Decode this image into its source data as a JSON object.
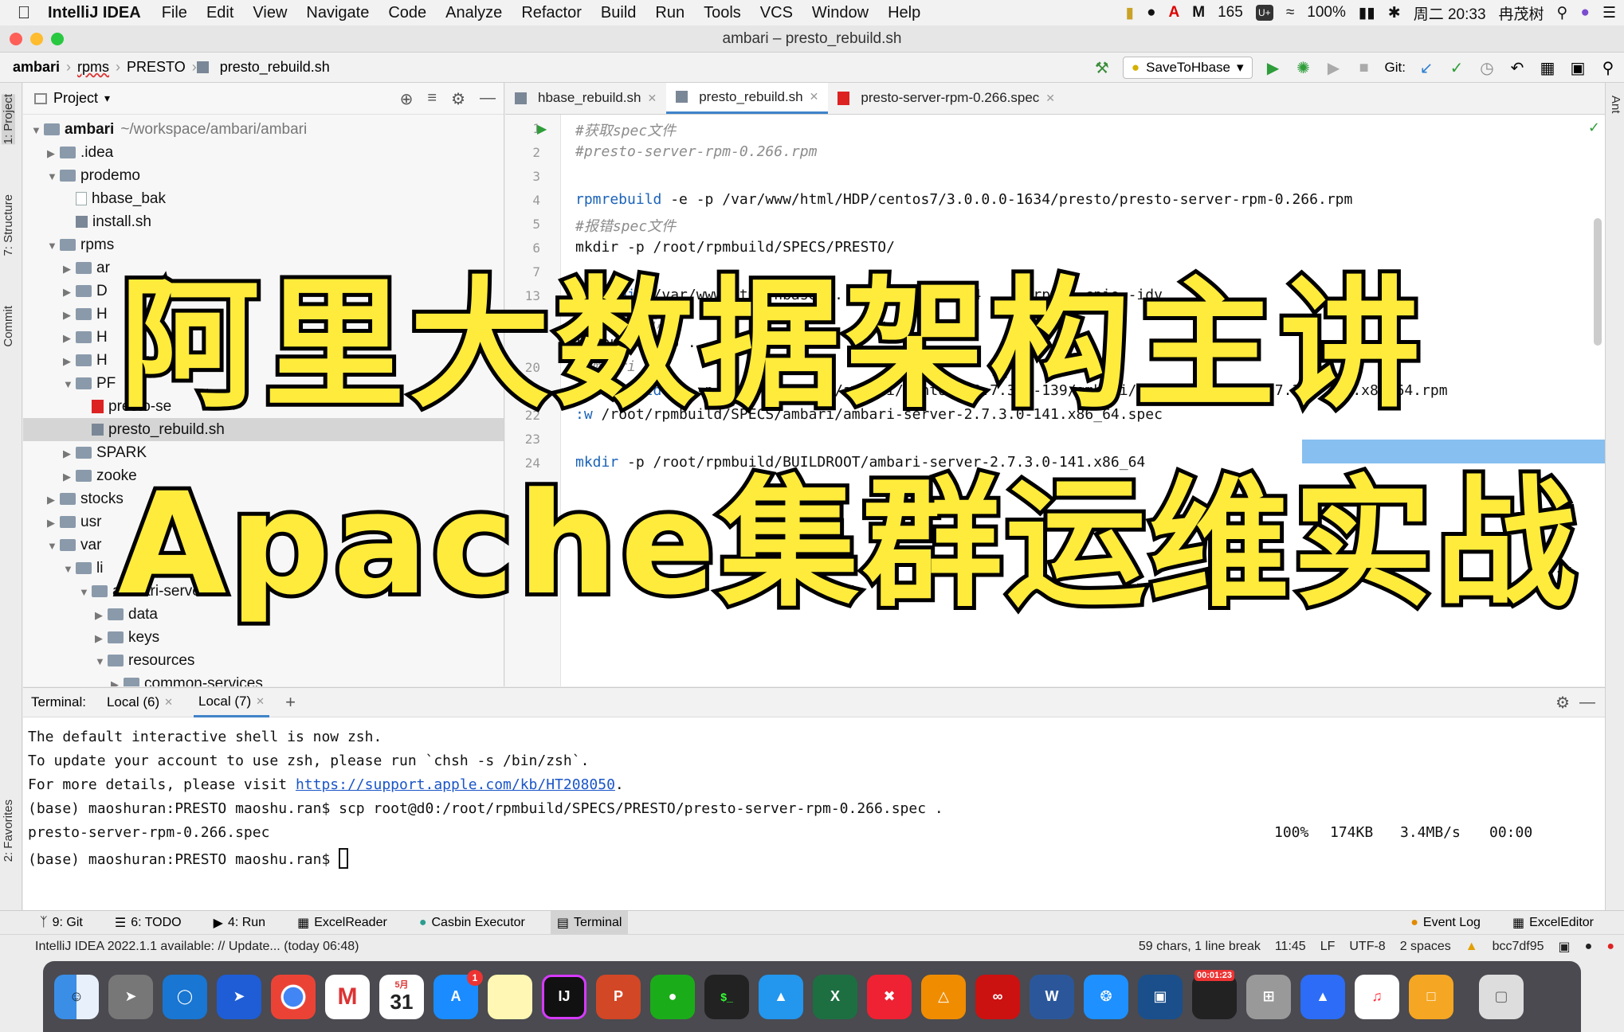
{
  "menubar": {
    "app_name": "IntelliJ IDEA",
    "items": [
      "File",
      "Edit",
      "View",
      "Navigate",
      "Code",
      "Analyze",
      "Refactor",
      "Build",
      "Run",
      "Tools",
      "VCS",
      "Window",
      "Help"
    ],
    "mail_count": "165",
    "battery": "100%",
    "datetime": "周二 20:33",
    "user": "冉茂树"
  },
  "window": {
    "title": "ambari – presto_rebuild.sh"
  },
  "navbar": {
    "breadcrumbs": [
      "ambari",
      "rpms",
      "PRESTO",
      "presto_rebuild.sh"
    ],
    "run_config": "SaveToHbase",
    "git_label": "Git:"
  },
  "leftstrip": {
    "project": "1: Project",
    "structure": "7: Structure",
    "commit": "Commit",
    "favorites": "2: Favorites"
  },
  "rightstrip": {
    "ant": "Ant"
  },
  "project": {
    "header": "Project",
    "tree": [
      {
        "label": "ambari",
        "suffix": "~/workspace/ambari/ambari",
        "level": 0,
        "type": "folder",
        "open": true
      },
      {
        "label": ".idea",
        "level": 1,
        "type": "folder",
        "open": false
      },
      {
        "label": "prodemo",
        "level": 1,
        "type": "folder",
        "open": true
      },
      {
        "label": "hbase_bak",
        "level": 2,
        "type": "file"
      },
      {
        "label": "install.sh",
        "level": 2,
        "type": "sh"
      },
      {
        "label": "rpms",
        "level": 1,
        "type": "folder",
        "open": true
      },
      {
        "label": "ar",
        "level": 2,
        "type": "folder",
        "open": false
      },
      {
        "label": "D",
        "level": 2,
        "type": "folder",
        "open": false
      },
      {
        "label": "H",
        "level": 2,
        "type": "folder",
        "open": false
      },
      {
        "label": "H",
        "level": 2,
        "type": "folder",
        "open": false
      },
      {
        "label": "H",
        "level": 2,
        "type": "folder",
        "open": false
      },
      {
        "label": "PF",
        "level": 2,
        "type": "folder",
        "open": true
      },
      {
        "label": "presto-se",
        "level": 3,
        "type": "rpm"
      },
      {
        "label": "presto_rebuild.sh",
        "level": 3,
        "type": "sh",
        "selected": true
      },
      {
        "label": "SPARK",
        "level": 2,
        "type": "folder",
        "open": false
      },
      {
        "label": "zooke",
        "level": 2,
        "type": "folder",
        "open": false
      },
      {
        "label": "stocks",
        "level": 1,
        "type": "folder",
        "open": false
      },
      {
        "label": "usr",
        "level": 1,
        "type": "folder",
        "open": false
      },
      {
        "label": "var",
        "level": 1,
        "type": "folder",
        "open": true
      },
      {
        "label": "li",
        "level": 2,
        "type": "folder",
        "open": true
      },
      {
        "label": "ambari-server",
        "level": 3,
        "type": "folder",
        "open": true
      },
      {
        "label": "data",
        "level": 4,
        "type": "folder",
        "open": false
      },
      {
        "label": "keys",
        "level": 4,
        "type": "folder",
        "open": false
      },
      {
        "label": "resources",
        "level": 4,
        "type": "folder",
        "open": true
      },
      {
        "label": "common-services",
        "level": 5,
        "type": "folder",
        "open": false
      }
    ]
  },
  "editor": {
    "tabs": [
      {
        "label": "hbase_rebuild.sh",
        "active": false,
        "type": "sh"
      },
      {
        "label": "presto_rebuild.sh",
        "active": true,
        "type": "sh"
      },
      {
        "label": "presto-server-rpm-0.266.spec",
        "active": false,
        "type": "rpm"
      }
    ],
    "lines": [
      {
        "n": "1",
        "text": "#获取spec文件",
        "kind": "comment"
      },
      {
        "n": "2",
        "text": "#presto-server-rpm-0.266.rpm",
        "kind": "comment"
      },
      {
        "n": "3",
        "text": "",
        "kind": "plain"
      },
      {
        "n": "4",
        "cmd": "rpmrebuild",
        "text": " -e -p /var/www/html/HDP/centos7/3.0.0.0-1634/presto/presto-server-rpm-0.266.rpm",
        "kind": "cmd"
      },
      {
        "n": "5",
        "text": "#报错spec文件",
        "kind": "comment"
      },
      {
        "n": "6",
        "text": "mkdir -p /root/rpmbuild/SPECS/PRESTO/",
        "kind": "plain"
      },
      {
        "n": "7",
        "text": "",
        "kind": "plain"
      },
      {
        "n": "13",
        "cmd": "rpm2cpio",
        "text": " /var/www/html/hbase ... 2.0.0 ... 1634 ... .rpm | cpio -idv",
        "kind": "cmd"
      },
      {
        "n": "",
        "text": "#修改完毕后,",
        "kind": "comment"
      },
      {
        "n": "",
        "text": "rpmbuild -bb ... spec",
        "kind": "plain"
      },
      {
        "n": "20",
        "text": "#ambari",
        "kind": "comment"
      },
      {
        "n": "21",
        "cmd": "rpmrebuild",
        "text": " -e -p /var/www/html/ambari/centos7/2.7.3.0-139/ambari/ambari-server-2.7.3.0-141.x86_64.rpm",
        "kind": "cmd"
      },
      {
        "n": "22",
        "cmd": ":w",
        "text": " /root/rpmbuild/SPECS/ambari/ambari-server-2.7.3.0-141.x86_64.spec",
        "kind": "cmd"
      },
      {
        "n": "23",
        "text": "",
        "kind": "plain"
      },
      {
        "n": "24",
        "cmd": "mkdir",
        "text": " -p /root/rpmbuild/BUILDROOT/ambari-server-2.7.3.0-141.x86_64",
        "kind": "cmd"
      }
    ]
  },
  "terminal": {
    "label": "Terminal:",
    "tabs": [
      "Local (6)",
      "Local (7)"
    ],
    "lines": [
      "The default interactive shell is now zsh.",
      "To update your account to use zsh, please run `chsh -s /bin/zsh`."
    ],
    "details_prefix": "For more details, please visit ",
    "details_link": "https://support.apple.com/kb/HT208050",
    "details_suffix": ".",
    "scp_cmd": "(base) maoshuran:PRESTO maoshu.ran$ scp root@d0:/root/rpmbuild/SPECS/PRESTO/presto-server-rpm-0.266.spec .",
    "transfer_file": "presto-server-rpm-0.266.spec",
    "transfer_pct": "100%",
    "transfer_size": "174KB",
    "transfer_rate": "3.4MB/s",
    "transfer_time": "00:00",
    "prompt": "(base) maoshuran:PRESTO maoshu.ran$ "
  },
  "toolwindows": {
    "left": [
      {
        "label": "9: Git"
      },
      {
        "label": "6: TODO"
      },
      {
        "label": "4: Run"
      },
      {
        "label": "ExcelReader"
      },
      {
        "label": "Casbin Executor"
      },
      {
        "label": "Terminal",
        "active": true
      }
    ],
    "right": [
      {
        "label": "Event Log"
      },
      {
        "label": "ExcelEditor"
      }
    ]
  },
  "status": {
    "message": "IntelliJ IDEA 2022.1.1 available: // Update... (today 06:48)",
    "chars": "59 chars, 1 line break",
    "position": "11:45",
    "line_sep": "LF",
    "encoding": "UTF-8",
    "indent": "2 spaces",
    "branch": "bcc7df95"
  },
  "dock": {
    "calendar_day": "31",
    "calendar_month": "5月",
    "appstore_badge": "1",
    "recorder_time": "00:01:23"
  },
  "overlay": {
    "line1": "阿里大数据架构主讲",
    "line2": "Apache集群运维实战"
  },
  "colors": {
    "accent": "#4083c9",
    "overlay_fill": "#ffeb3b",
    "overlay_stroke": "#000000"
  }
}
